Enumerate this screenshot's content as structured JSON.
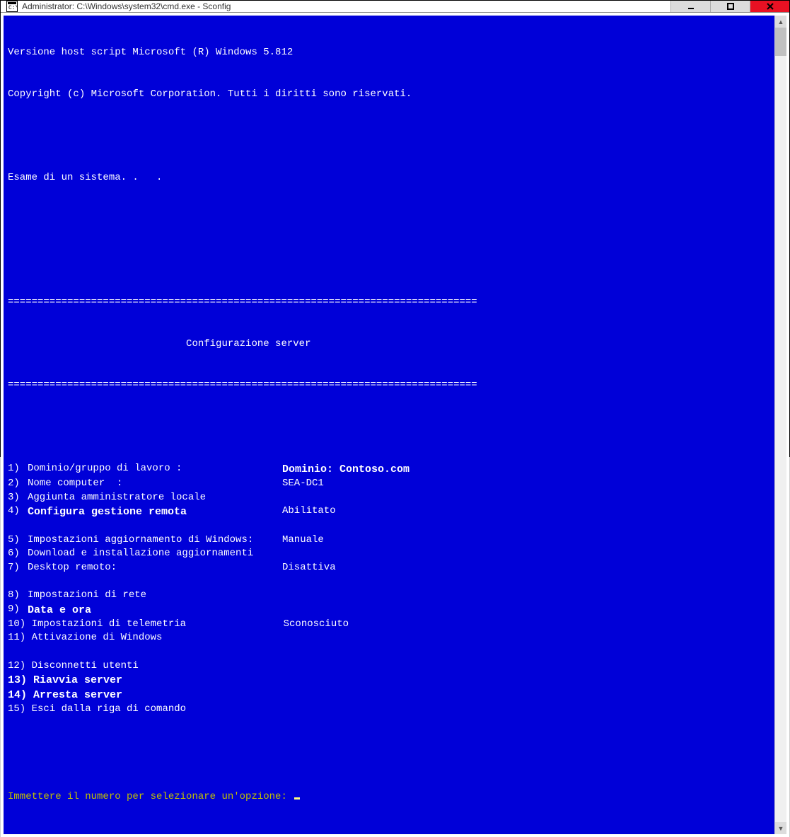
{
  "titlebar": {
    "title": "Administrator: C:\\Windows\\system32\\cmd.exe - Sconfig",
    "minimize": "━",
    "maximize": "◻",
    "close": "✕"
  },
  "header": {
    "line1": "Versione host script Microsoft (R) Windows 5.812",
    "line2": "Copyright (c) Microsoft Corporation. Tutti i diritti sono riservati.",
    "examining": "Esame di un sistema. .   ."
  },
  "divider": "===============================================================================",
  "section_title": "                              Configurazione server",
  "menu": {
    "items": [
      {
        "num": "1) ",
        "label": "Dominio/gruppo di lavoro :",
        "value": "Dominio: Contoso.com",
        "em_value": true
      },
      {
        "num": "2) ",
        "label": "Nome computer  :",
        "value": "SEA-DC1"
      },
      {
        "num": "3) ",
        "label": "Aggiunta amministratore locale",
        "value": ""
      },
      {
        "num": "4) ",
        "label": "Configura gestione remota",
        "value": "Abilitato",
        "em_label": true
      },
      {
        "spacer": true
      },
      {
        "num": "5) ",
        "label": "Impostazioni aggiornamento di Windows:",
        "value": "Manuale"
      },
      {
        "num": "6) ",
        "label": "Download e installazione aggiornamenti",
        "value": ""
      },
      {
        "num": "7) ",
        "label": "Desktop remoto:",
        "value": "Disattiva"
      },
      {
        "spacer": true
      },
      {
        "num": "8) ",
        "label": "Impostazioni di rete",
        "value": ""
      },
      {
        "num": "9) ",
        "label": "Data e ora",
        "value": "",
        "em_label": true
      },
      {
        "num": "10) ",
        "label": "Impostazioni di telemetria",
        "value": "Sconosciuto",
        "compact": true
      },
      {
        "num": "11) ",
        "label": "Attivazione di Windows",
        "value": "",
        "compact": true
      },
      {
        "spacer": true
      },
      {
        "num": "12) ",
        "label": "Disconnetti utenti",
        "value": "",
        "compact": true
      },
      {
        "num": "13) ",
        "label": "Riavvia server",
        "value": "",
        "compact": true,
        "em_row": true
      },
      {
        "num": "14) ",
        "label": "Arresta server",
        "value": "",
        "compact": true,
        "em_row": true
      },
      {
        "num": "15) ",
        "label": "Esci dalla riga di comando",
        "value": "",
        "compact": true
      }
    ]
  },
  "prompt": "Immettere il numero per selezionare un'opzione:"
}
